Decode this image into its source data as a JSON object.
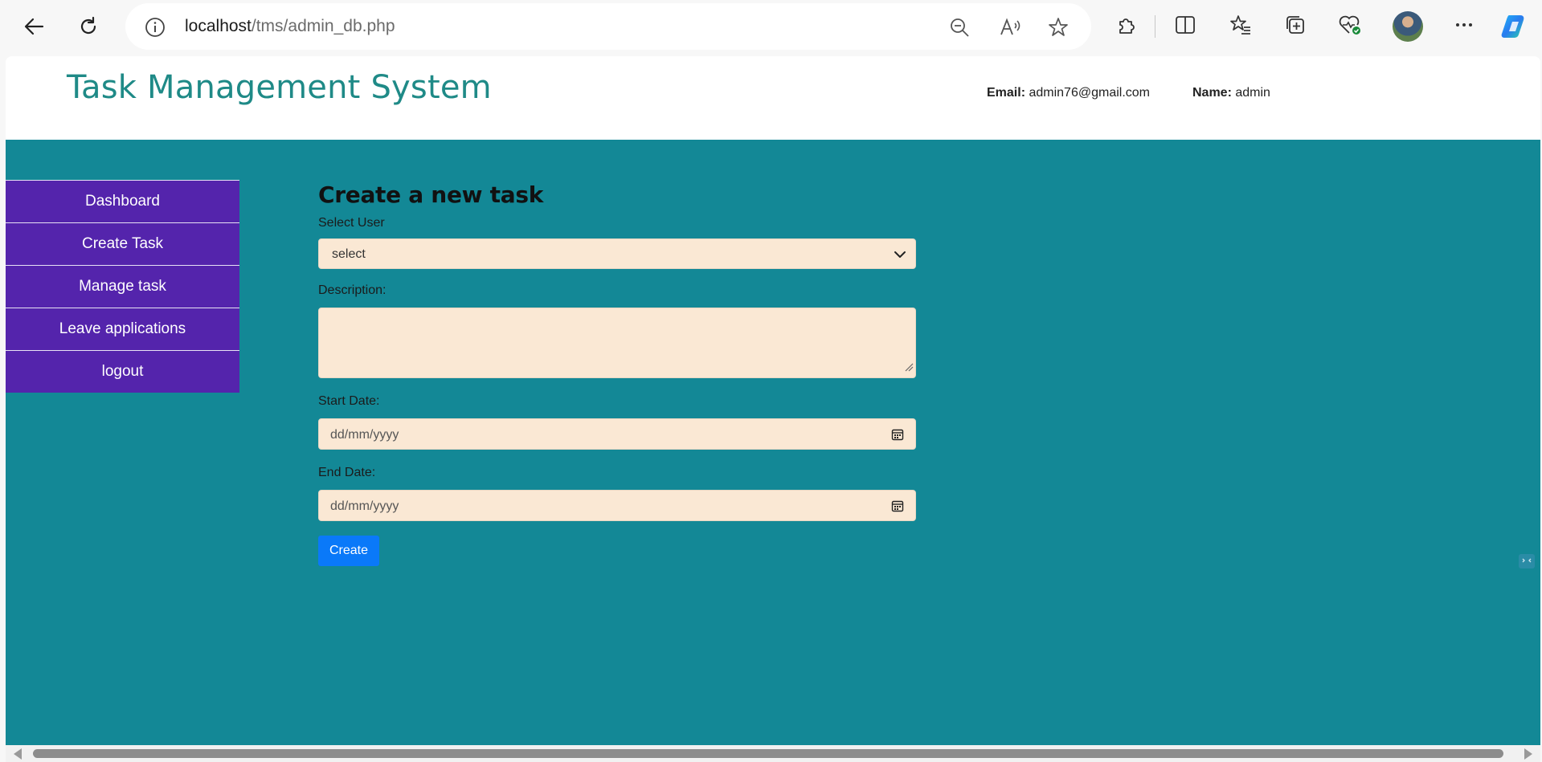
{
  "browser": {
    "url_host": "localhost",
    "url_path": "/tms/admin_db.php"
  },
  "header": {
    "title": "Task Management System",
    "email_label": "Email:",
    "email_value": "admin76@gmail.com",
    "name_label": "Name:",
    "name_value": "admin"
  },
  "sidebar": {
    "items": [
      {
        "label": "Dashboard"
      },
      {
        "label": "Create Task"
      },
      {
        "label": "Manage task"
      },
      {
        "label": "Leave applications"
      },
      {
        "label": "logout"
      }
    ]
  },
  "form": {
    "heading": "Create a new task",
    "select_user_label": "Select User",
    "select_user_value": "select",
    "description_label": "Description:",
    "description_value": "",
    "start_date_label": "Start Date:",
    "start_date_placeholder": "dd/mm/yyyy",
    "end_date_label": "End Date:",
    "end_date_placeholder": "dd/mm/yyyy",
    "submit_label": "Create"
  },
  "colors": {
    "title": "#1f8a87",
    "content_bg": "#138896",
    "sidebar_bg": "#5424ac",
    "field_bg": "#fae8d4",
    "button_bg": "#0a79f9"
  }
}
